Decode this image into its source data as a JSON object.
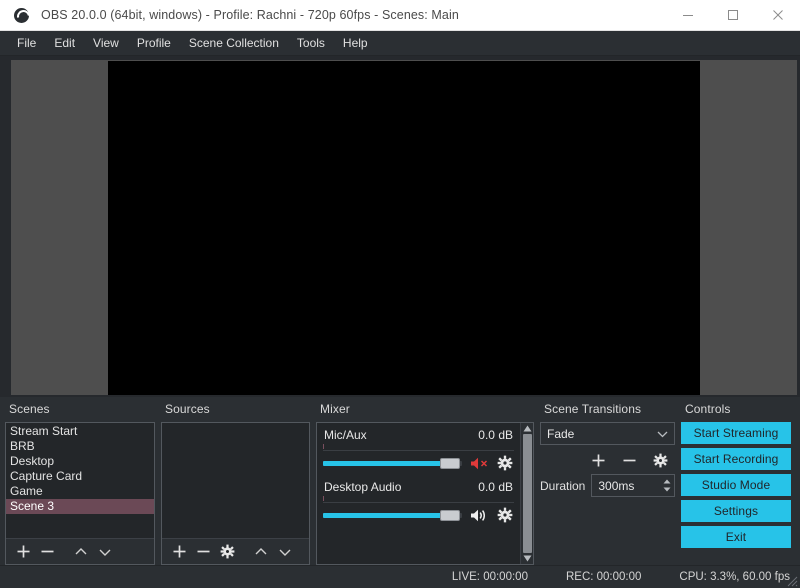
{
  "window": {
    "title": "OBS 20.0.0 (64bit, windows) - Profile: Rachni - 720p 60fps - Scenes: Main",
    "minimize_label": "Minimize",
    "maximize_label": "Maximize",
    "close_label": "Close",
    "logo_icon": "obs-logo-icon"
  },
  "menubar": {
    "items": [
      {
        "label": "File"
      },
      {
        "label": "Edit"
      },
      {
        "label": "View"
      },
      {
        "label": "Profile"
      },
      {
        "label": "Scene Collection"
      },
      {
        "label": "Tools"
      },
      {
        "label": "Help"
      }
    ]
  },
  "preview": {
    "canvas_color": "#000000",
    "background_color": "#4e4e4e"
  },
  "scenes": {
    "title": "Scenes",
    "items": [
      {
        "label": "Stream Start",
        "selected": false
      },
      {
        "label": "BRB",
        "selected": false
      },
      {
        "label": "Desktop",
        "selected": false
      },
      {
        "label": "Capture Card",
        "selected": false
      },
      {
        "label": "Game",
        "selected": false
      },
      {
        "label": "Scene 3",
        "selected": true
      }
    ],
    "selected_color": "#6b4956",
    "toolbar": [
      {
        "icon": "plus-icon",
        "name": "add-scene-button"
      },
      {
        "icon": "minus-icon",
        "name": "remove-scene-button"
      },
      {
        "icon": "chevron-up-icon",
        "name": "move-scene-up-button"
      },
      {
        "icon": "chevron-down-icon",
        "name": "move-scene-down-button"
      }
    ]
  },
  "sources": {
    "title": "Sources",
    "items": [],
    "toolbar": [
      {
        "icon": "plus-icon",
        "name": "add-source-button"
      },
      {
        "icon": "minus-icon",
        "name": "remove-source-button"
      },
      {
        "icon": "gear-icon",
        "name": "source-properties-button"
      },
      {
        "icon": "chevron-up-icon",
        "name": "move-source-up-button"
      },
      {
        "icon": "chevron-down-icon",
        "name": "move-source-down-button"
      }
    ]
  },
  "mixer": {
    "title": "Mixer",
    "channels": [
      {
        "name": "Mic/Aux",
        "db": "0.0 dB",
        "volume_percent": 85,
        "muted": true,
        "mute_icon": "speaker-muted-icon",
        "gear_icon": "gear-icon"
      },
      {
        "name": "Desktop Audio",
        "db": "0.0 dB",
        "volume_percent": 85,
        "muted": false,
        "mute_icon": "speaker-on-icon",
        "gear_icon": "gear-icon"
      }
    ],
    "slider_color": "#27c3e8",
    "muted_color": "#e03a3a"
  },
  "transitions": {
    "title": "Scene Transitions",
    "selected_transition": "Fade",
    "dropdown_icon": "chevron-down-icon",
    "toolbar": [
      {
        "icon": "plus-icon",
        "name": "add-transition-button"
      },
      {
        "icon": "minus-icon",
        "name": "remove-transition-button"
      },
      {
        "icon": "gear-icon",
        "name": "transition-properties-button"
      }
    ],
    "duration_label": "Duration",
    "duration_value": "300ms"
  },
  "controls": {
    "title": "Controls",
    "accent_color": "#27c3e8",
    "buttons": [
      {
        "label": "Start Streaming",
        "name": "start-streaming-button"
      },
      {
        "label": "Start Recording",
        "name": "start-recording-button"
      },
      {
        "label": "Studio Mode",
        "name": "studio-mode-button"
      },
      {
        "label": "Settings",
        "name": "settings-button"
      },
      {
        "label": "Exit",
        "name": "exit-button"
      }
    ]
  },
  "statusbar": {
    "live": "LIVE: 00:00:00",
    "rec": "REC: 00:00:00",
    "cpu": "CPU: 3.3%, 60.00 fps"
  }
}
